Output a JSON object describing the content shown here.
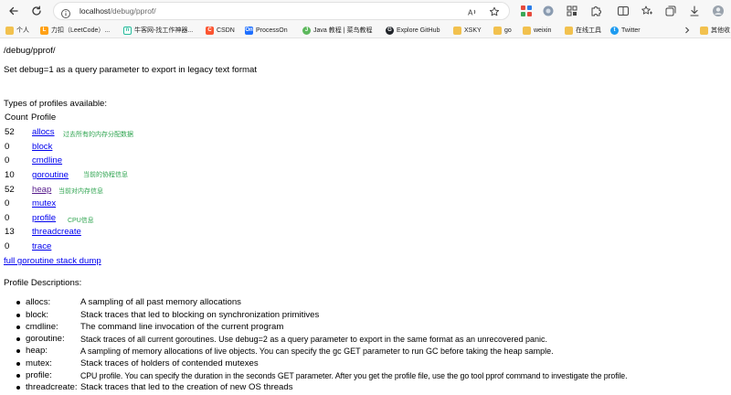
{
  "browser": {
    "url_host": "localhost",
    "url_path": "/debug/pprof/"
  },
  "bookmarks": [
    {
      "label": "个人",
      "icon": "folder-icon"
    },
    {
      "label": "力扣（LeetCode）...",
      "icon": "leetcode-icon"
    },
    {
      "label": "牛客网-找工作神器...",
      "icon": "nowcoder-icon"
    },
    {
      "label": "CSDN",
      "icon": "csdn-icon"
    },
    {
      "label": "ProcessOn",
      "icon": "processon-icon"
    },
    {
      "label": "Java 教程 | 菜鸟教程",
      "icon": "runoob-icon"
    },
    {
      "label": "Explore GitHub",
      "icon": "github-icon"
    },
    {
      "label": "XSKY",
      "icon": "folder-icon"
    },
    {
      "label": "go",
      "icon": "folder-icon"
    },
    {
      "label": "weixin",
      "icon": "folder-icon"
    },
    {
      "label": "在线工具",
      "icon": "folder-icon"
    },
    {
      "label": "Twitter",
      "icon": "twitter-icon"
    },
    {
      "label": "其他收",
      "icon": "folder-icon"
    }
  ],
  "page": {
    "heading": "/debug/pprof/",
    "intro": "Set debug=1 as a query parameter to export in legacy text format",
    "types_title": "Types of profiles available:",
    "col_count": "Count",
    "col_profile": "Profile",
    "profiles": [
      {
        "count": "52",
        "name": "allocs"
      },
      {
        "count": "0",
        "name": "block"
      },
      {
        "count": "0",
        "name": "cmdline"
      },
      {
        "count": "10",
        "name": "goroutine"
      },
      {
        "count": "52",
        "name": "heap"
      },
      {
        "count": "0",
        "name": "mutex"
      },
      {
        "count": "0",
        "name": "profile"
      },
      {
        "count": "13",
        "name": "threadcreate"
      },
      {
        "count": "0",
        "name": "trace"
      }
    ],
    "notes": {
      "allocs": "过去所有的内存分配数据",
      "goroutine": "当前的协程信息",
      "heap": "当前对内存信息",
      "profile": "CPU信息"
    },
    "full_dump": "full goroutine stack dump",
    "desc_title": "Profile Descriptions:",
    "descriptions": [
      {
        "name": "allocs:",
        "text": "A sampling of all past memory allocations"
      },
      {
        "name": "block:",
        "text": "Stack traces that led to blocking on synchronization primitives"
      },
      {
        "name": "cmdline:",
        "text": "The command line invocation of the current program"
      },
      {
        "name": "goroutine:",
        "text": "Stack traces of all current goroutines. Use debug=2 as a query parameter to export in the same format as an unrecovered panic."
      },
      {
        "name": "heap:",
        "text": "A sampling of memory allocations of live objects. You can specify the gc GET parameter to run GC before taking the heap sample."
      },
      {
        "name": "mutex:",
        "text": "Stack traces of holders of contended mutexes"
      },
      {
        "name": "profile:",
        "text": "CPU profile. You can specify the duration in the seconds GET parameter. After you get the profile file, use the go tool pprof command to investigate the profile."
      },
      {
        "name": "threadcreate:",
        "text": "Stack traces that led to the creation of new OS threads"
      }
    ]
  }
}
